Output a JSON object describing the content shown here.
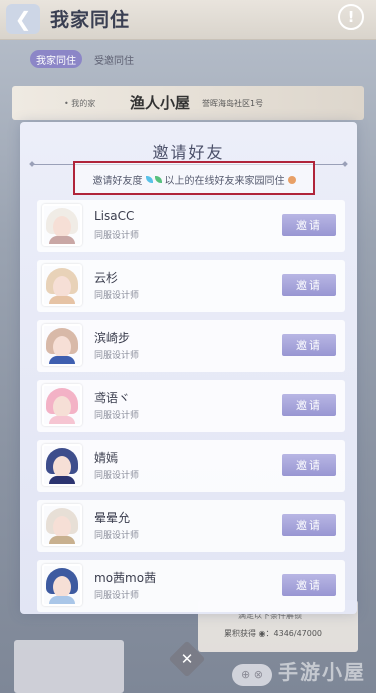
{
  "background": {
    "title": "我家同住",
    "tabs": [
      "我家同住",
      "受邀同住"
    ],
    "card": {
      "tag": "• 我的家",
      "name": "渔人小屋",
      "address": "誉晖海岛社区1号"
    },
    "bottom_panel": {
      "line1": "满足以下条件解锁",
      "line2": "累积获得 ◉：4346/47000"
    },
    "watermark": "手游小屋"
  },
  "modal": {
    "title": "邀请好友",
    "hint_prefix": "邀请好友度",
    "hint_suffix": "以上的在线好友来家园同住",
    "invite_label": "邀请",
    "friends": [
      {
        "name": "LisaCC",
        "role": "同服设计师",
        "hair": "#f0ece6",
        "outfit": "#c9a7a5"
      },
      {
        "name": "云杉",
        "role": "同服设计师",
        "hair": "#e8d2b8",
        "outfit": "#e6c3a5"
      },
      {
        "name": "滨崎步",
        "role": "同服设计师",
        "hair": "#d8b9a8",
        "outfit": "#3f5fb0"
      },
      {
        "name": "鸢语ヾ",
        "role": "同服设计师",
        "hair": "#f3b2c6",
        "outfit": "#f6c5d2"
      },
      {
        "name": "婧嫣",
        "role": "同服设计师",
        "hair": "#3d4d8c",
        "outfit": "#2c3470"
      },
      {
        "name": "晕晕允",
        "role": "同服设计师",
        "hair": "#e7dfd6",
        "outfit": "#c8b08f"
      },
      {
        "name": "mo茜mo茜",
        "role": "同服设计师",
        "hair": "#3d5aa0",
        "outfit": "#a9c6e8"
      }
    ]
  }
}
